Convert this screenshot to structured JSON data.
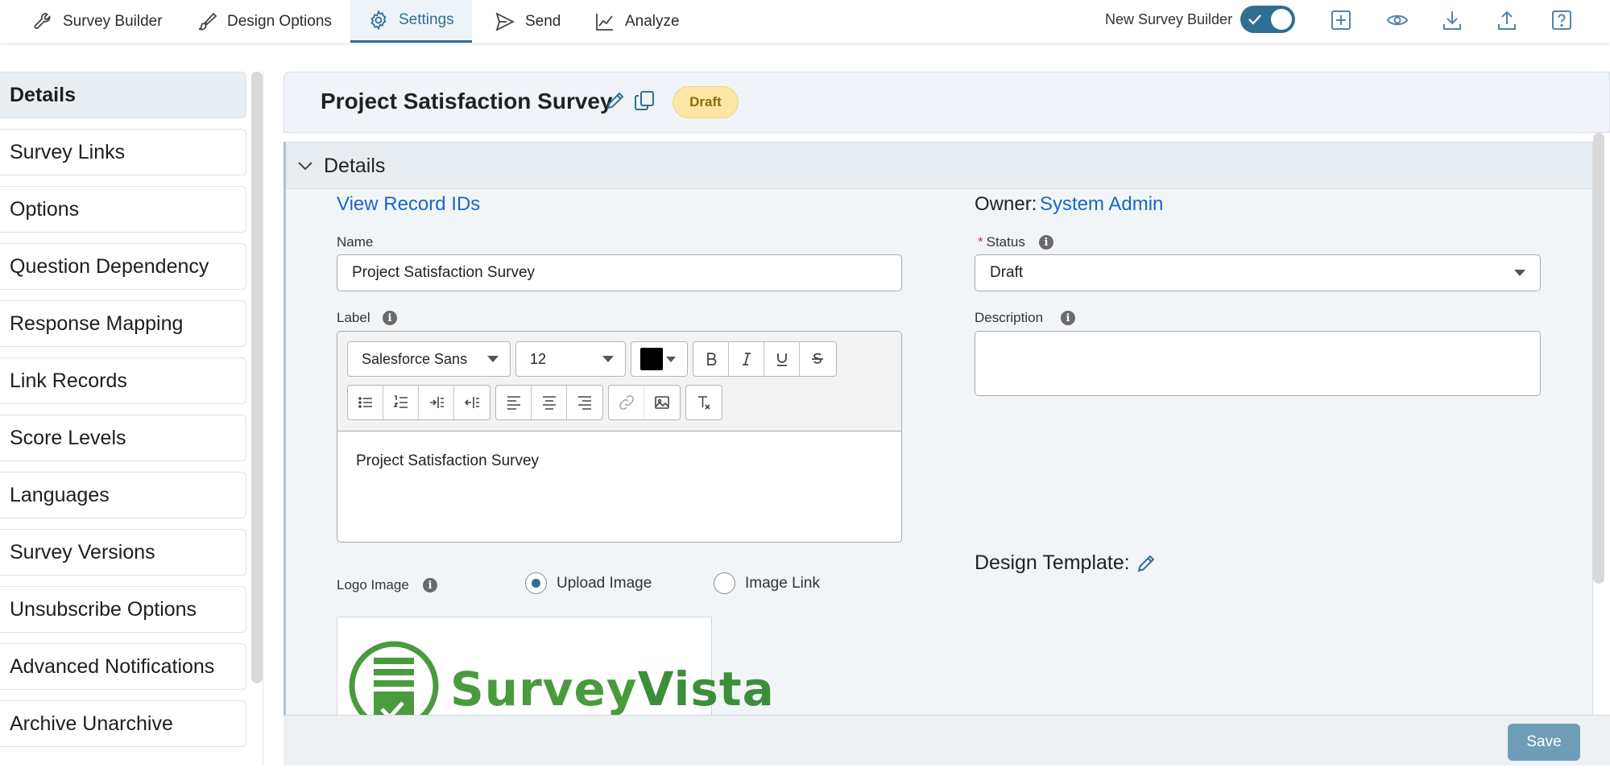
{
  "topnav": {
    "tabs": [
      {
        "label": "Survey Builder",
        "icon": "wrench-icon"
      },
      {
        "label": "Design Options",
        "icon": "brush-icon"
      },
      {
        "label": "Settings",
        "icon": "gear-icon",
        "active": true
      },
      {
        "label": "Send",
        "icon": "send-icon"
      },
      {
        "label": "Analyze",
        "icon": "chart-line-icon"
      }
    ],
    "new_survey_builder_label": "New Survey Builder",
    "new_survey_builder_on": true,
    "tool_icons": [
      "add-box-icon",
      "eye-icon",
      "download-icon",
      "upload-icon",
      "help-icon"
    ]
  },
  "sidebar": {
    "items": [
      {
        "label": "Details",
        "active": true
      },
      {
        "label": "Survey Links"
      },
      {
        "label": "Options"
      },
      {
        "label": "Question Dependency"
      },
      {
        "label": "Response Mapping"
      },
      {
        "label": "Link Records"
      },
      {
        "label": "Score Levels"
      },
      {
        "label": "Languages"
      },
      {
        "label": "Survey Versions"
      },
      {
        "label": "Unsubscribe Options"
      },
      {
        "label": "Advanced Notifications"
      },
      {
        "label": "Archive Unarchive"
      }
    ]
  },
  "header": {
    "title": "Project Satisfaction Survey",
    "status_badge": "Draft"
  },
  "details": {
    "heading": "Details",
    "view_record_ids": "View Record IDs",
    "owner_label": "Owner:",
    "owner_value": "System Admin",
    "name_label": "Name",
    "name_value": "Project Satisfaction Survey",
    "status_required": "*",
    "status_label": "Status",
    "status_value": "Draft",
    "label_label": "Label",
    "description_label": "Description",
    "description_value": "",
    "rte": {
      "font_family": "Salesforce Sans",
      "font_size": "12",
      "text_color": "#000000",
      "content": "Project Satisfaction Survey"
    },
    "logo_label": "Logo Image",
    "logo_options": [
      "Upload Image",
      "Image Link"
    ],
    "logo_selected": "Upload Image",
    "logo_brand": {
      "survey": "Survey",
      "vista": "Vista"
    },
    "design_template_label": "Design Template:"
  },
  "footer": {
    "save_label": "Save"
  },
  "colors": {
    "accent": "#2f6f91",
    "link": "#1a66c7",
    "logo_green": "#4a9a3e",
    "badge_bg": "#fbe6a6"
  }
}
